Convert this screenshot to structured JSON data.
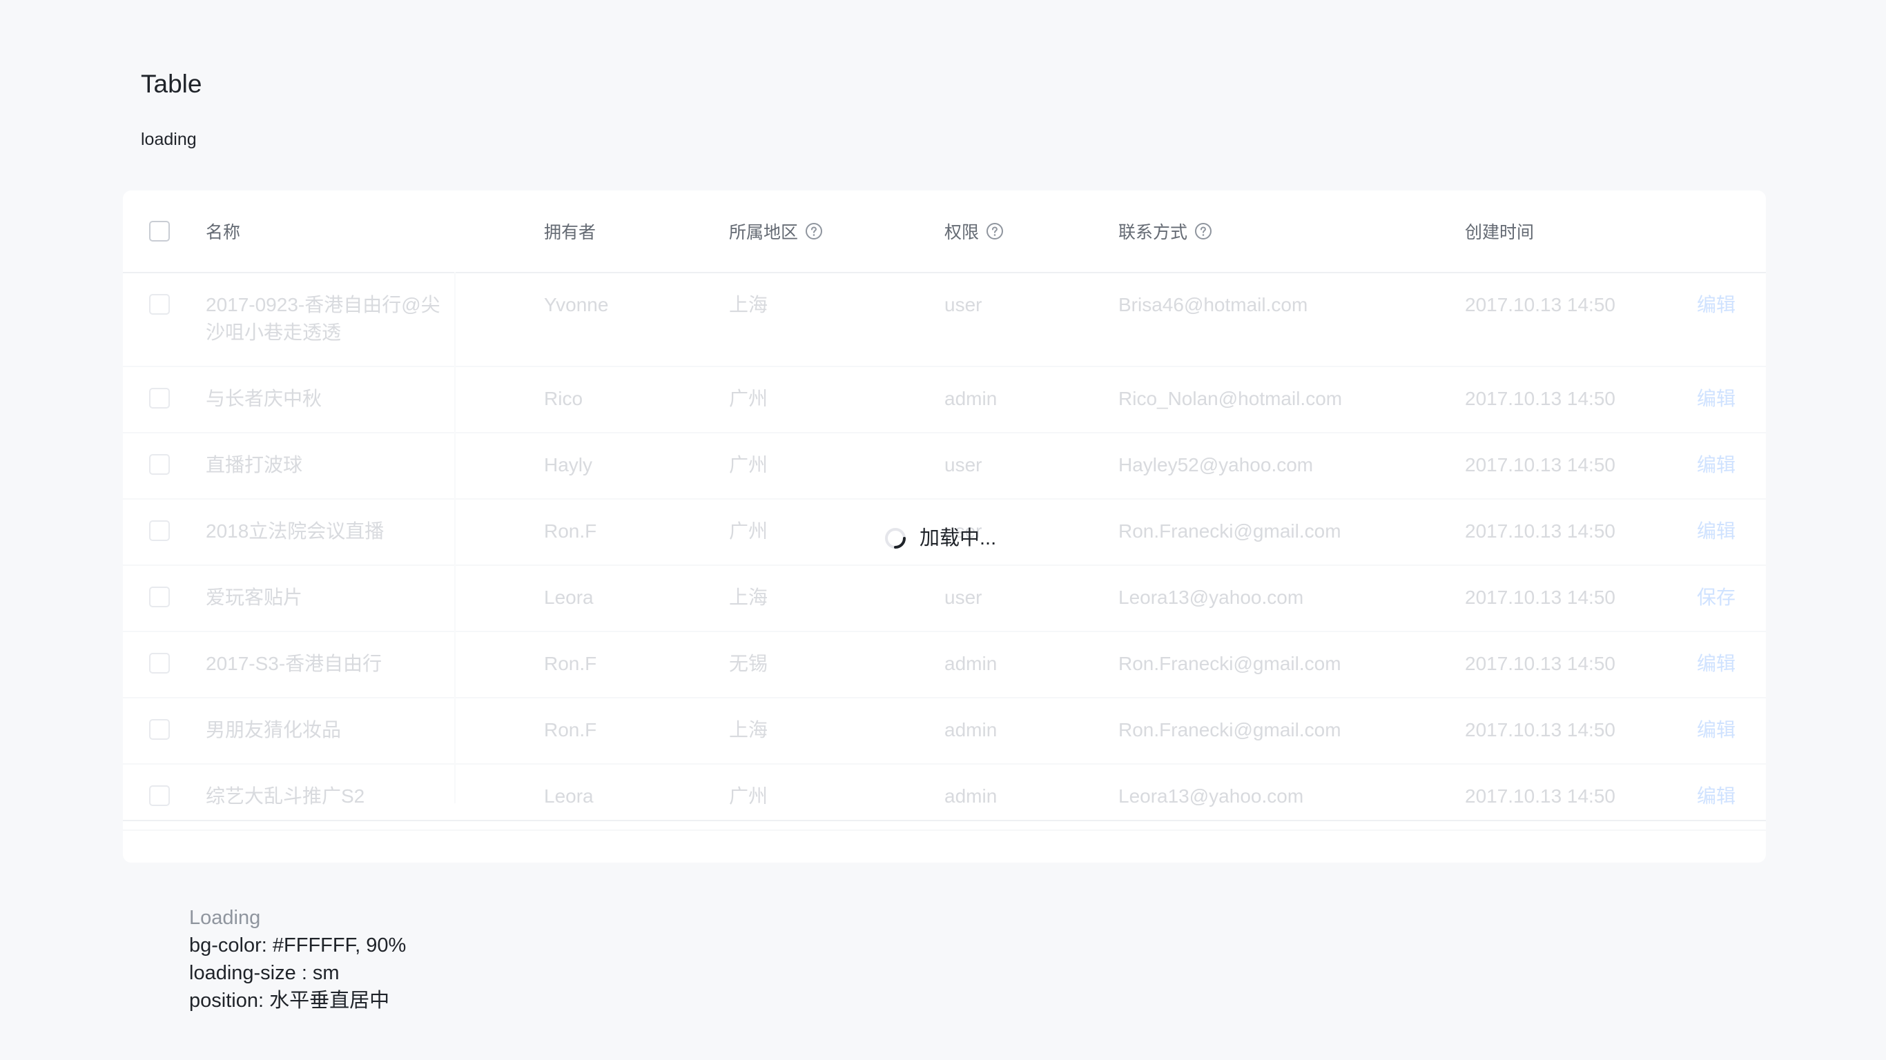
{
  "page": {
    "title": "Table",
    "subtitle": "loading"
  },
  "table": {
    "headers": {
      "name": "名称",
      "owner": "拥有者",
      "region": "所属地区",
      "permission": "权限",
      "contact": "联系方式",
      "created": "创建时间"
    },
    "rows": [
      {
        "name": "2017-0923-香港自由行@尖沙咀小巷走透透",
        "owner": "Yvonne",
        "region": "上海",
        "permission": "user",
        "contact": "Brisa46@hotmail.com",
        "created": "2017.10.13 14:50",
        "action": "编辑"
      },
      {
        "name": "与长者庆中秋",
        "owner": "Rico",
        "region": "广州",
        "permission": "admin",
        "contact": "Rico_Nolan@hotmail.com",
        "created": "2017.10.13 14:50",
        "action": "编辑"
      },
      {
        "name": "直播打波球",
        "owner": "Hayly",
        "region": "广州",
        "permission": "user",
        "contact": "Hayley52@yahoo.com",
        "created": "2017.10.13 14:50",
        "action": "编辑"
      },
      {
        "name": "2018立法院会议直播",
        "owner": "Ron.F",
        "region": "广州",
        "permission": "user",
        "contact": "Ron.Franecki@gmail.com",
        "created": "2017.10.13 14:50",
        "action": "编辑"
      },
      {
        "name": "爱玩客贴片",
        "owner": "Leora",
        "region": "上海",
        "permission": "user",
        "contact": "Leora13@yahoo.com",
        "created": "2017.10.13 14:50",
        "action": "保存"
      },
      {
        "name": "2017-S3-香港自由行",
        "owner": "Ron.F",
        "region": "无锡",
        "permission": "admin",
        "contact": "Ron.Franecki@gmail.com",
        "created": "2017.10.13 14:50",
        "action": "编辑"
      },
      {
        "name": "男朋友猜化妆品",
        "owner": "Ron.F",
        "region": "上海",
        "permission": "admin",
        "contact": "Ron.Franecki@gmail.com",
        "created": "2017.10.13 14:50",
        "action": "编辑"
      },
      {
        "name": "综艺大乱斗推广S2",
        "owner": "Leora",
        "region": "广州",
        "permission": "admin",
        "contact": "Leora13@yahoo.com",
        "created": "2017.10.13 14:50",
        "action": "编辑"
      }
    ]
  },
  "loading": {
    "text": "加载中..."
  },
  "notes": {
    "title": "Loading",
    "lines": [
      "bg-color: #FFFFFF, 90%",
      "loading-size : sm",
      "position: 水平垂直居中"
    ]
  },
  "colors": {
    "background": "#f7f8fa",
    "card": "#ffffff",
    "primary": "#3370ff",
    "text": "#1f2329",
    "muted_text": "#8f959e"
  }
}
